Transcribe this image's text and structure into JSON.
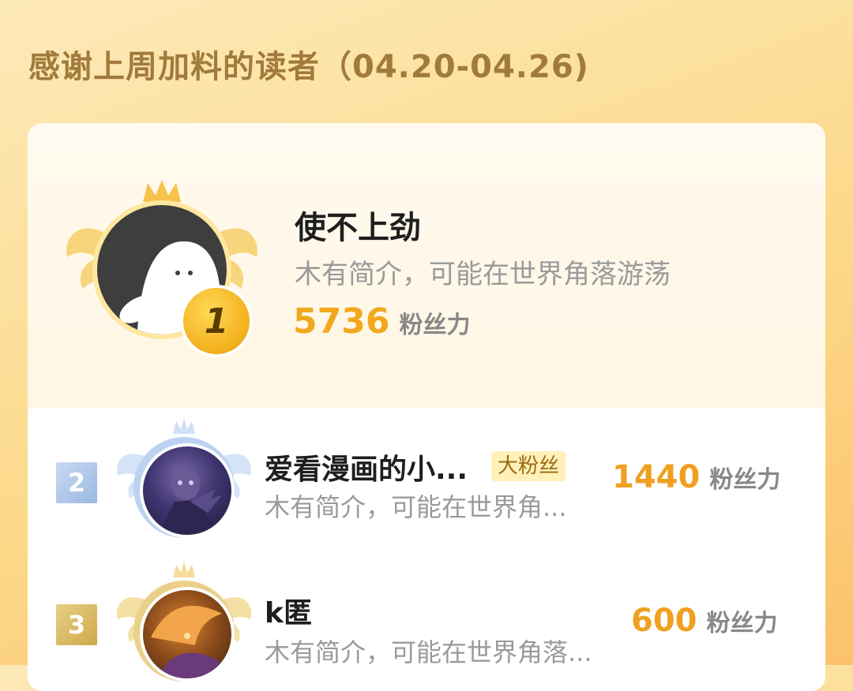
{
  "header": {
    "title": "感谢上周加料的读者（04.20-04.26)"
  },
  "ranking": [
    {
      "rank": "1",
      "name": "使不上劲",
      "bio": "木有简介，可能在世界角落游荡",
      "score": "5736",
      "unit": "粉丝力",
      "badge": "",
      "avatar": "ghost-avatar"
    },
    {
      "rank": "2",
      "name": "爱看漫画的小...",
      "bio": "木有简介，可能在世界角...",
      "score": "1440",
      "unit": "粉丝力",
      "badge": "大粉丝",
      "avatar": "anime-character-avatar"
    },
    {
      "rank": "3",
      "name": "k匿",
      "bio": "木有简介，可能在世界角落...",
      "score": "600",
      "unit": "粉丝力",
      "badge": "",
      "avatar": "fox-character-avatar"
    }
  ],
  "colors": {
    "gold": "#f2a81d",
    "silver_badge": "#aec6e8",
    "bronze_badge": "#d8bc6c",
    "score_orange": "#f0a020"
  }
}
